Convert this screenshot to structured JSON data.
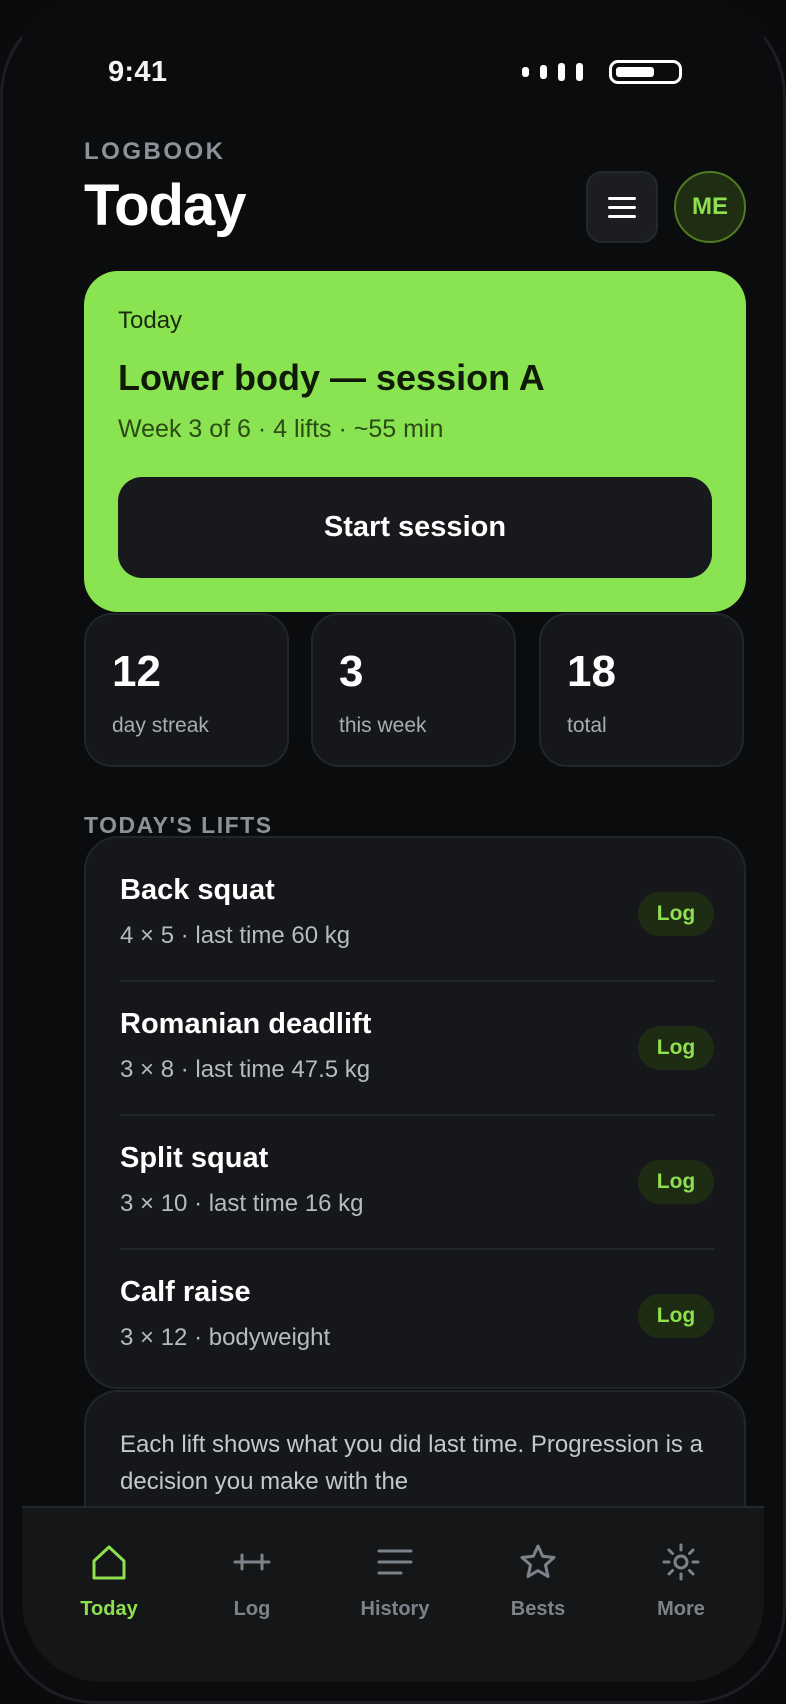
{
  "status_bar": {
    "time": "9:41"
  },
  "header": {
    "overline": "LOGBOOK",
    "title": "Today",
    "avatar_initials": "ME"
  },
  "hero": {
    "label": "Today",
    "title": "Lower body — session A",
    "meta": "Week 3 of 6 · 4 lifts · ~55 min",
    "button_label": "Start session"
  },
  "stats": [
    {
      "value": "12",
      "label": "day streak"
    },
    {
      "value": "3",
      "label": "this week"
    },
    {
      "value": "18",
      "label": "total"
    }
  ],
  "lifts_section": {
    "label": "TODAY'S LIFTS",
    "items": [
      {
        "name": "Back squat",
        "meta": "4 × 5 · last time 60 kg",
        "action": "Log"
      },
      {
        "name": "Romanian deadlift",
        "meta": "3 × 8 · last time 47.5 kg",
        "action": "Log"
      },
      {
        "name": "Split squat",
        "meta": "3 × 10 · last time 16 kg",
        "action": "Log"
      },
      {
        "name": "Calf raise",
        "meta": "3 × 12 · bodyweight",
        "action": "Log"
      }
    ]
  },
  "note": {
    "text": "Each lift shows what you did last time. Progression is a decision you make with the"
  },
  "tabbar": {
    "tabs": [
      {
        "label": "Today",
        "icon": "home-icon",
        "active": true
      },
      {
        "label": "Log",
        "icon": "barbell-icon",
        "active": false
      },
      {
        "label": "History",
        "icon": "list-icon",
        "active": false
      },
      {
        "label": "Bests",
        "icon": "star-icon",
        "active": false
      },
      {
        "label": "More",
        "icon": "gear-icon",
        "active": false
      }
    ]
  },
  "colors": {
    "accent": "#8ae350",
    "background": "#0b0c0e",
    "card": "#15171a"
  }
}
